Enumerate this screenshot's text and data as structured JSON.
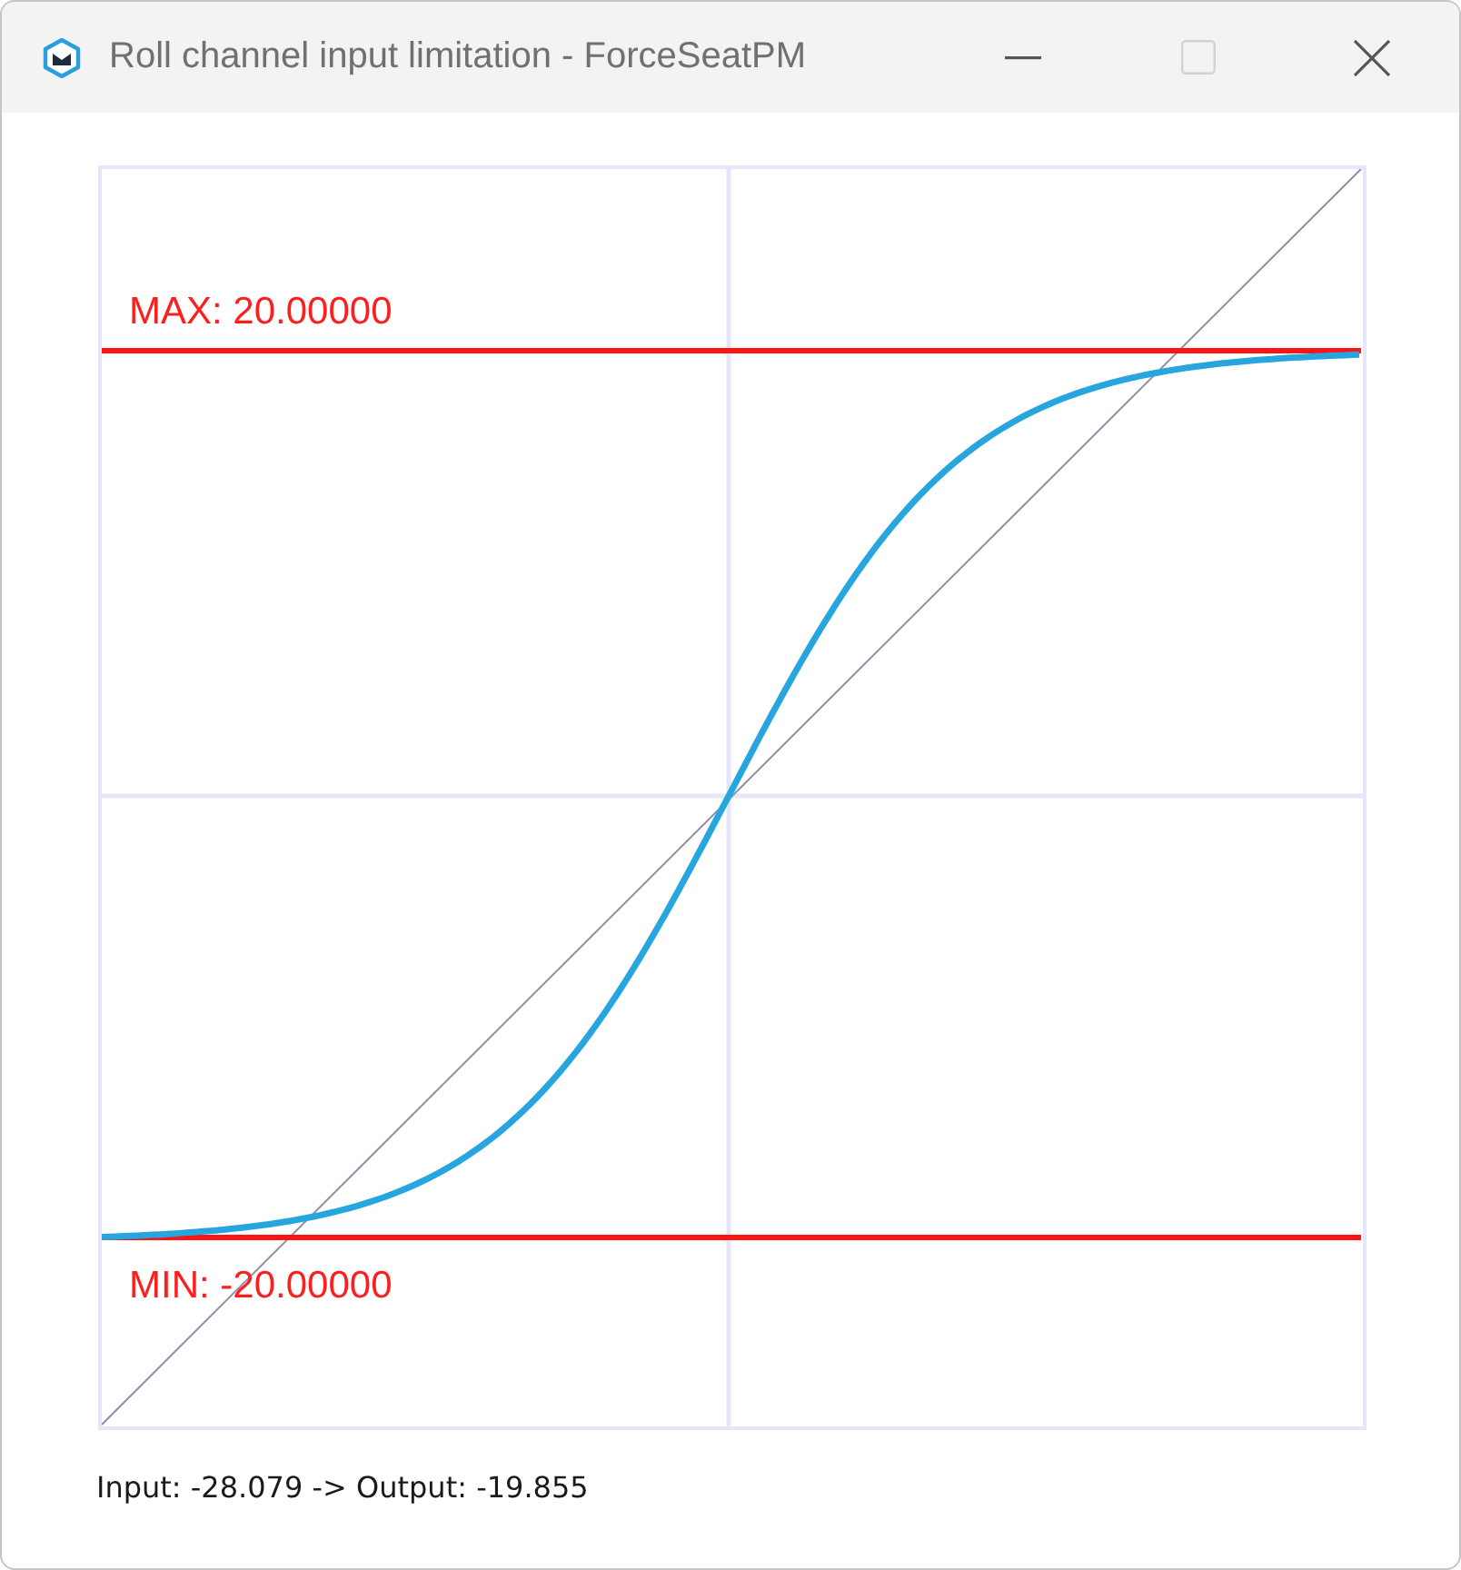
{
  "window": {
    "title": "Roll channel input limitation - ForceSeatPM",
    "buttons": [
      {
        "kind": "minimize",
        "disabled": false
      },
      {
        "kind": "maximize",
        "disabled": true
      },
      {
        "kind": "close",
        "disabled": false
      }
    ]
  },
  "plot": {
    "max_label": "MAX: 20.00000",
    "min_label": "MIN: -20.00000"
  },
  "readout": "Input: -28.079 -> Output: -19.855"
}
